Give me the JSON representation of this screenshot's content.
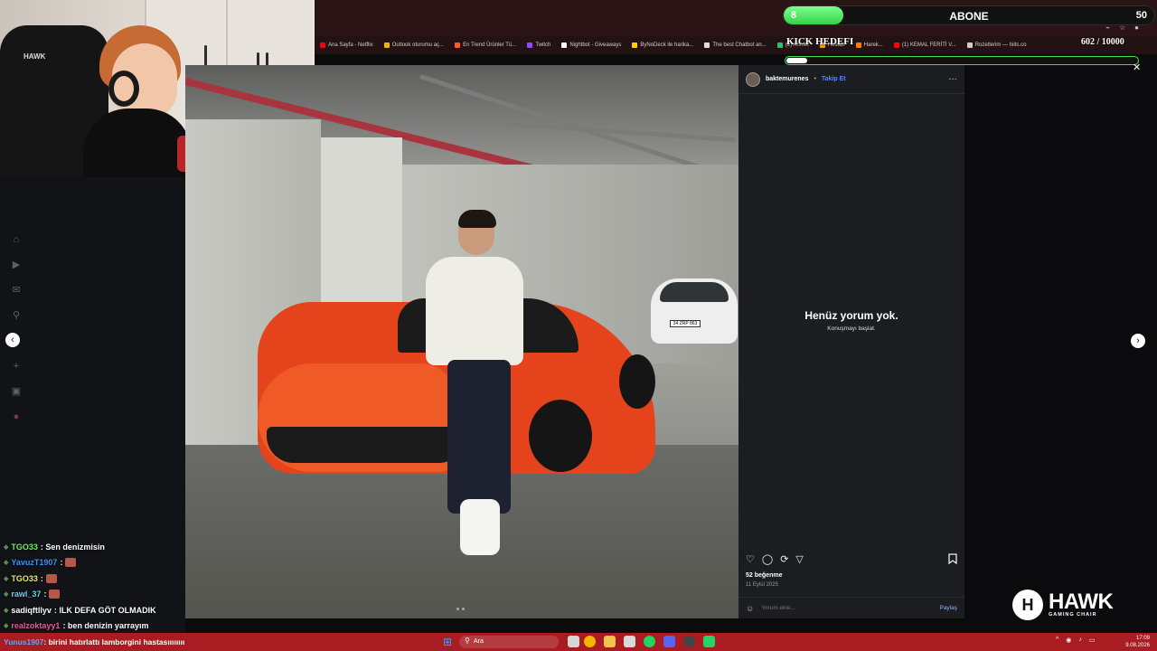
{
  "overlay": {
    "abone_count": "8",
    "abone_title": "ABONE",
    "abone_target": "50",
    "abone_progress": 0.16,
    "kick_title": "KICK HEDEFI",
    "kick_count": "602 / 10000",
    "kick_progress": 0.06
  },
  "bookmarks": [
    {
      "label": "Ana Sayfa - Netflix",
      "color": "#e50914"
    },
    {
      "label": "Outlook oturumu aç...",
      "color": "#f3b10a"
    },
    {
      "label": "En Trend Ürünler Tü...",
      "color": "#ff5a1f"
    },
    {
      "label": "Twitch",
      "color": "#9146ff"
    },
    {
      "label": "Nightbot - Giveaways",
      "color": "#ffffff"
    },
    {
      "label": "ByNoDeck ile harika...",
      "color": "#ffcc00"
    },
    {
      "label": "The best Chatbot an...",
      "color": "#dddddd"
    },
    {
      "label": "(2) Ahmet",
      "color": "#2fbf71"
    },
    {
      "label": "Hesabı",
      "color": "#ff9900"
    },
    {
      "label": "Harek...",
      "color": "#ff7a00"
    },
    {
      "label": "(1) KEMAL FERİTİ V...",
      "color": "#ff0000"
    },
    {
      "label": "Rozetlerim — hiits.co",
      "color": "#cccccc"
    }
  ],
  "instagram": {
    "username": "baktemurenes",
    "separator": "•",
    "follow_label": "Takip Et",
    "more_icon": "…",
    "empty_title": "Henüz yorum yok.",
    "empty_subtitle": "Konuşmayı başlat.",
    "likes": "52 beğenme",
    "date": "11 Eylül 2025",
    "comment_placeholder": "Yorum ekle...",
    "share_label": "Paylaş",
    "icons": {
      "like": "♡",
      "comment": "◯",
      "repost": "⟳",
      "send": "▽",
      "save": "🔖",
      "emoji": "☺"
    }
  },
  "photo": {
    "plate": "34 ZRP 863"
  },
  "nav": {
    "prev": "‹",
    "next": "›",
    "close": "✕"
  },
  "chat": [
    {
      "user": "TGO33",
      "user_color": "#7be86a",
      "message": ": Sen denizmisin",
      "emote": false
    },
    {
      "user": "YavuzT1907",
      "user_color": "#3f8cff",
      "message": " :",
      "emote": true
    },
    {
      "user": "TGO33",
      "user_color": "#e8e86a",
      "message": " :",
      "emote": true
    },
    {
      "user": "rawl_37",
      "user_color": "#6ad0e8",
      "message": " :",
      "emote": true
    },
    {
      "user": "sadiqftllyv",
      "user_color": "#ffffff",
      "message": ": ILK DEFA GÖT OLMADIK",
      "emote": false
    },
    {
      "user": "realzoktayy1",
      "user_color": "#d85fa0",
      "message": ": ben denizin yarrayım",
      "emote": false
    }
  ],
  "ticker": {
    "user": "Yunus1907",
    "message": ": birini hatırlattı lamborgini hastasıııııııı"
  },
  "hawk": {
    "word": "HAWK",
    "subtitle": "GAMING CHAIR",
    "mark": "H"
  },
  "webcam": {
    "chair_logo": "HAWK"
  },
  "taskbar": {
    "search_label": "Ara",
    "time": "17:09",
    "date": "9.08.2026",
    "weather": "28°C"
  },
  "colors": {
    "accent_green": "#35d14b",
    "ig_blue": "#4f8cff",
    "taskbar_red": "#a81c22"
  }
}
